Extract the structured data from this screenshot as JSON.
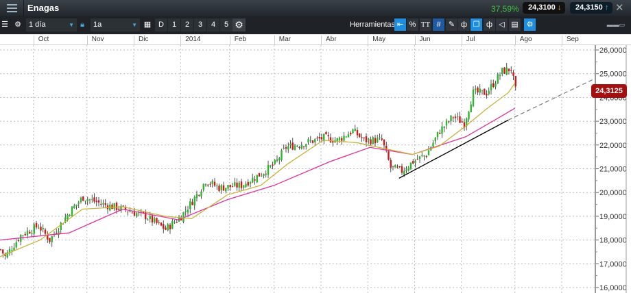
{
  "header": {
    "title": "Enagas",
    "change": "37,59%",
    "bid": "24,3100",
    "ask": "24,3150",
    "close": "✕"
  },
  "toolbar": {
    "interval": "1 día",
    "range": "1a",
    "day_buttons": [
      "D",
      "1",
      "2",
      "3",
      "4",
      "5"
    ],
    "tools_label": "Herramientas",
    "percent": "%",
    "text_tool": "TT"
  },
  "colors": {
    "up": "#2db52d",
    "down": "#d01818",
    "ma_short": "#c8b23a",
    "ma_long": "#e0309a"
  },
  "chart_data": {
    "type": "candlestick",
    "x_unit": "trading day index",
    "months": [
      {
        "label": "Oct",
        "day": 15
      },
      {
        "label": "Nov",
        "day": 39
      },
      {
        "label": "Dic",
        "day": 60
      },
      {
        "label": "2014",
        "day": 81
      },
      {
        "label": "Feb",
        "day": 103
      },
      {
        "label": "Mar",
        "day": 123
      },
      {
        "label": "Abr",
        "day": 144
      },
      {
        "label": "May",
        "day": 165
      },
      {
        "label": "Jun",
        "day": 186
      },
      {
        "label": "Jul",
        "day": 207
      },
      {
        "label": "Ago",
        "day": 231
      },
      {
        "label": "Sep",
        "day": 252
      }
    ],
    "ylim": [
      16,
      26
    ],
    "yticks": [
      "16,0000",
      "17,0000",
      "18,0000",
      "19,0000",
      "20,0000",
      "21,0000",
      "22,0000",
      "23,0000",
      "24,0000",
      "25,0000",
      "26,0000"
    ],
    "price_path": [
      [
        0,
        17.6
      ],
      [
        2,
        17.3
      ],
      [
        9,
        18.2
      ],
      [
        17,
        18.6
      ],
      [
        22,
        18.0
      ],
      [
        31,
        19.2
      ],
      [
        37,
        19.8
      ],
      [
        46,
        19.5
      ],
      [
        55,
        19.3
      ],
      [
        65,
        19.0
      ],
      [
        74,
        18.45
      ],
      [
        81,
        19.0
      ],
      [
        88,
        19.9
      ],
      [
        92,
        20.5
      ],
      [
        98,
        20.2
      ],
      [
        108,
        20.3
      ],
      [
        117,
        20.8
      ],
      [
        123,
        21.2
      ],
      [
        128,
        21.9
      ],
      [
        135,
        22.05
      ],
      [
        145,
        22.3
      ],
      [
        151,
        22.2
      ],
      [
        158,
        22.6
      ],
      [
        163,
        22.2
      ],
      [
        171,
        22.2
      ],
      [
        175,
        21.05
      ],
      [
        180,
        20.9
      ],
      [
        185,
        21.3
      ],
      [
        191,
        21.6
      ],
      [
        197,
        22.6
      ],
      [
        203,
        23.2
      ],
      [
        208,
        22.9
      ],
      [
        212,
        24.2
      ],
      [
        218,
        24.2
      ],
      [
        225,
        25.1
      ],
      [
        229,
        25.2
      ],
      [
        231,
        24.3
      ]
    ],
    "ma_short": [
      [
        0,
        17.3
      ],
      [
        18,
        18.0
      ],
      [
        37,
        19.3
      ],
      [
        55,
        19.4
      ],
      [
        74,
        19.0
      ],
      [
        86,
        18.9
      ],
      [
        102,
        19.9
      ],
      [
        117,
        20.3
      ],
      [
        129,
        21.2
      ],
      [
        145,
        22.2
      ],
      [
        160,
        22.1
      ],
      [
        175,
        21.8
      ],
      [
        185,
        21.6
      ],
      [
        197,
        21.95
      ],
      [
        209,
        22.8
      ],
      [
        218,
        23.5
      ],
      [
        228,
        24.2
      ],
      [
        231,
        24.6
      ]
    ],
    "ma_long": [
      [
        0,
        18.0
      ],
      [
        31,
        18.3
      ],
      [
        55,
        19.3
      ],
      [
        80,
        18.85
      ],
      [
        102,
        19.7
      ],
      [
        123,
        20.3
      ],
      [
        148,
        21.3
      ],
      [
        166,
        21.9
      ],
      [
        185,
        21.6
      ],
      [
        209,
        22.35
      ],
      [
        222,
        23.05
      ],
      [
        231,
        23.55
      ]
    ],
    "trendline": {
      "from": [
        179,
        20.6
      ],
      "to": [
        228,
        23.05
      ],
      "extension_to": [
        267,
        24.8
      ]
    },
    "last_price": "24,3125"
  }
}
